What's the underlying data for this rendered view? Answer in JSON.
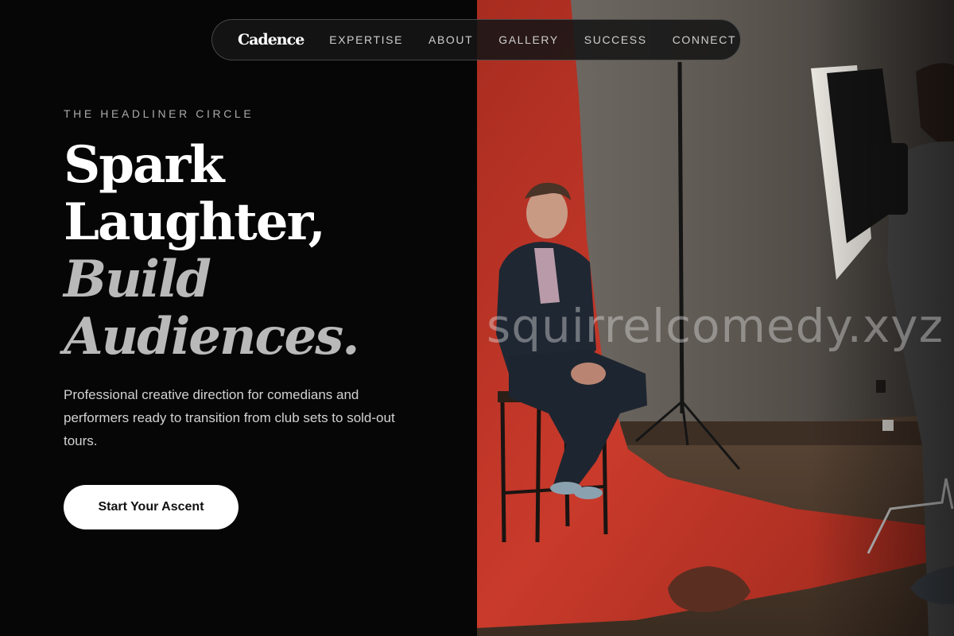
{
  "nav": {
    "brand": "Cadence",
    "links": [
      "EXPERTISE",
      "ABOUT",
      "GALLERY",
      "SUCCESS",
      "CONNECT"
    ]
  },
  "hero": {
    "eyebrow": "THE HEADLINER CIRCLE",
    "headline_line1": "Spark",
    "headline_line2": "Laughter,",
    "headline_line3": "Build",
    "headline_line4": "Audiences.",
    "description": "Professional creative direction for comedians and performers ready to transition from club sets to sold-out tours.",
    "cta_label": "Start Your Ascent"
  },
  "photo": {
    "subject": "comedian seated on a stool against a red backdrop in a photo studio",
    "watermark": "squirrelcomedy.xyz"
  },
  "colors": {
    "background": "#060606",
    "headline": "#ffffff",
    "headline_accent": "#b9b9b9",
    "cta_background": "#ffffff",
    "backdrop_red": "#c93a2b"
  }
}
